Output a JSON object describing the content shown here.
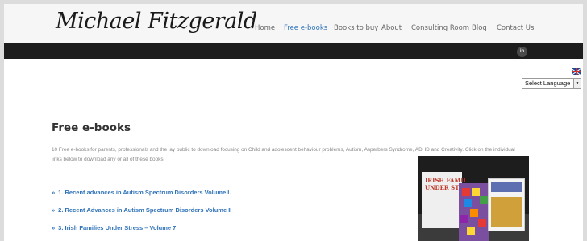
{
  "header": {
    "logo_text": "Michael Fitzgerald",
    "nav": [
      {
        "label": "Home",
        "active": false
      },
      {
        "label": "Free e-books",
        "active": true
      },
      {
        "label": "Books to buy",
        "active": false
      },
      {
        "label": "About",
        "active": false
      },
      {
        "label": "Consulting Room",
        "active": false
      },
      {
        "label": "Blog",
        "active": false
      },
      {
        "label": "Contact Us",
        "active": false
      }
    ],
    "social_icon_label": "in"
  },
  "language": {
    "flag_icon": "uk-flag-icon",
    "select_value": "Select Language"
  },
  "main": {
    "title": "Free e-books",
    "intro": "10 Free e-books for parents, professionals and the lay public to download focusing on Child and adolescent behaviour problems, Autism, Asperbers Syndrome, ADHD and Creativity.  Click on the individual links below to download any or all of these books.",
    "links": [
      "1. Recent advances in Autism Spectrum Disorders Volume I.",
      "2. Recent Advances in Autism Spectrum Disorders Volume II",
      "3. Irish Families Under Stress – Volume 7"
    ]
  },
  "image": {
    "cover_line1": "IRISH FAMIL",
    "cover_line2": "UNDER STRES"
  },
  "colors": {
    "accent": "#2f73b8",
    "header_bg": "#f6f6f6",
    "dark_bar": "#1c1c1c"
  }
}
